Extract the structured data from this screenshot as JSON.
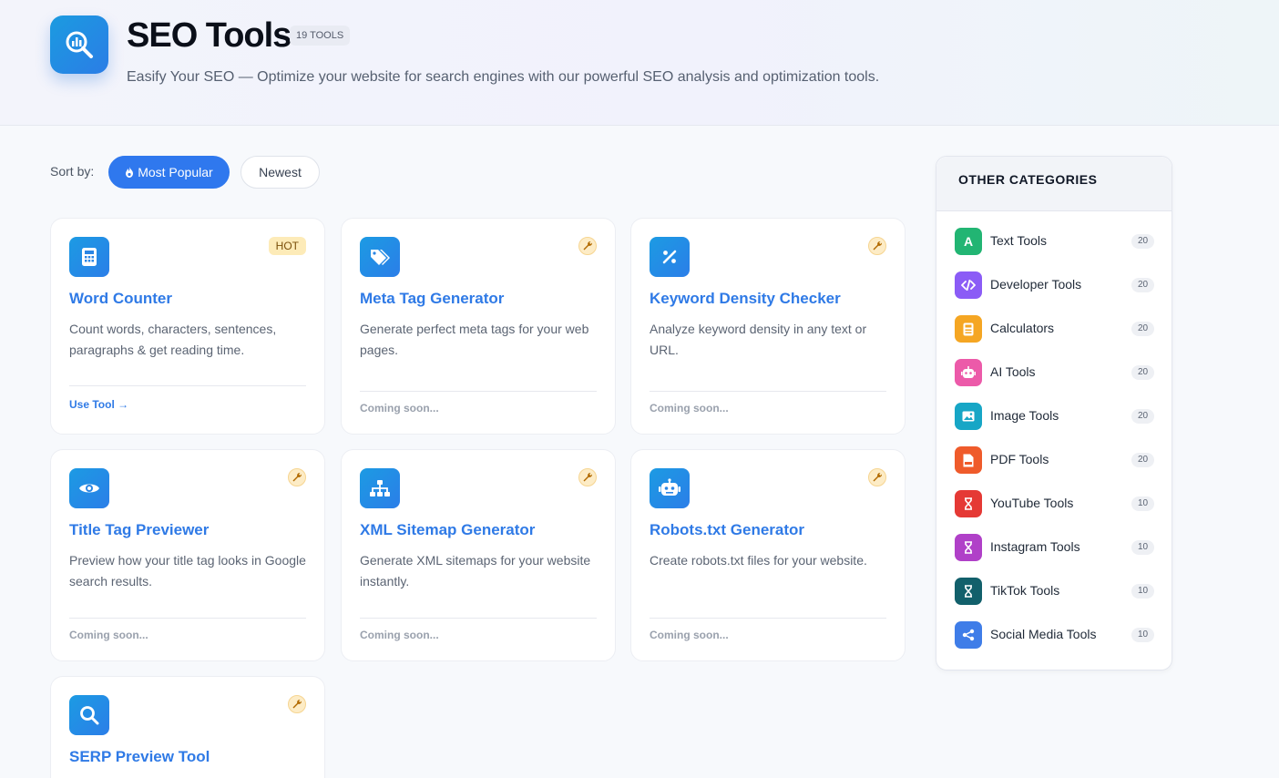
{
  "header": {
    "title": "SEO Tools",
    "badge": "19 TOOLS",
    "subtitle": "Easify Your SEO — Optimize your website for search engines with our powerful SEO analysis and optimization tools.",
    "icon": "search-chart-icon"
  },
  "sort": {
    "label": "Sort by:",
    "popular": "Most Popular",
    "newest": "Newest"
  },
  "tools": [
    {
      "title": "Word Counter",
      "desc": "Count words, characters, sentences, paragraphs & get reading time.",
      "footer": "Use Tool →",
      "badge": "HOT",
      "icon": "calculator-icon"
    },
    {
      "title": "Meta Tag Generator",
      "desc": "Generate perfect meta tags for your web pages.",
      "footer": "Coming soon...",
      "icon": "tags-icon"
    },
    {
      "title": "Keyword Density Checker",
      "desc": "Analyze keyword density in any text or URL.",
      "footer": "Coming soon...",
      "icon": "percent-icon"
    },
    {
      "title": "Title Tag Previewer",
      "desc": "Preview how your title tag looks in Google search results.",
      "footer": "Coming soon...",
      "icon": "eye-icon"
    },
    {
      "title": "XML Sitemap Generator",
      "desc": "Generate XML sitemaps for your website instantly.",
      "footer": "Coming soon...",
      "icon": "sitemap-icon"
    },
    {
      "title": "Robots.txt Generator",
      "desc": "Create robots.txt files for your website.",
      "footer": "Coming soon...",
      "icon": "robot-icon"
    },
    {
      "title": "SERP Preview Tool",
      "desc": "",
      "footer": "",
      "icon": "search-icon"
    }
  ],
  "sidebar": {
    "heading": "OTHER CATEGORIES",
    "categories": [
      {
        "label": "Text Tools",
        "count": "20",
        "color": "#22b573",
        "icon": "letter-a-icon"
      },
      {
        "label": "Developer Tools",
        "count": "20",
        "color": "#8b5cf6",
        "icon": "code-icon"
      },
      {
        "label": "Calculators",
        "count": "20",
        "color": "#f5a623",
        "icon": "calculator-icon"
      },
      {
        "label": "AI Tools",
        "count": "20",
        "color": "#ec5aa9",
        "icon": "robot-icon"
      },
      {
        "label": "Image Tools",
        "count": "20",
        "color": "#17a6c6",
        "icon": "image-icon"
      },
      {
        "label": "PDF Tools",
        "count": "20",
        "color": "#ef5b2b",
        "icon": "pdf-icon"
      },
      {
        "label": "YouTube Tools",
        "count": "10",
        "color": "#e53935",
        "icon": "hourglass-icon"
      },
      {
        "label": "Instagram Tools",
        "count": "10",
        "color": "#b040c8",
        "icon": "hourglass-icon"
      },
      {
        "label": "TikTok Tools",
        "count": "10",
        "color": "#12606b",
        "icon": "hourglass-icon"
      },
      {
        "label": "Social Media Tools",
        "count": "10",
        "color": "#3f7de8",
        "icon": "share-icon"
      }
    ]
  },
  "colors": {
    "accent": "#2f78ee",
    "title_blue": "#2f7ae6",
    "hot_bg": "#fdebb8"
  }
}
